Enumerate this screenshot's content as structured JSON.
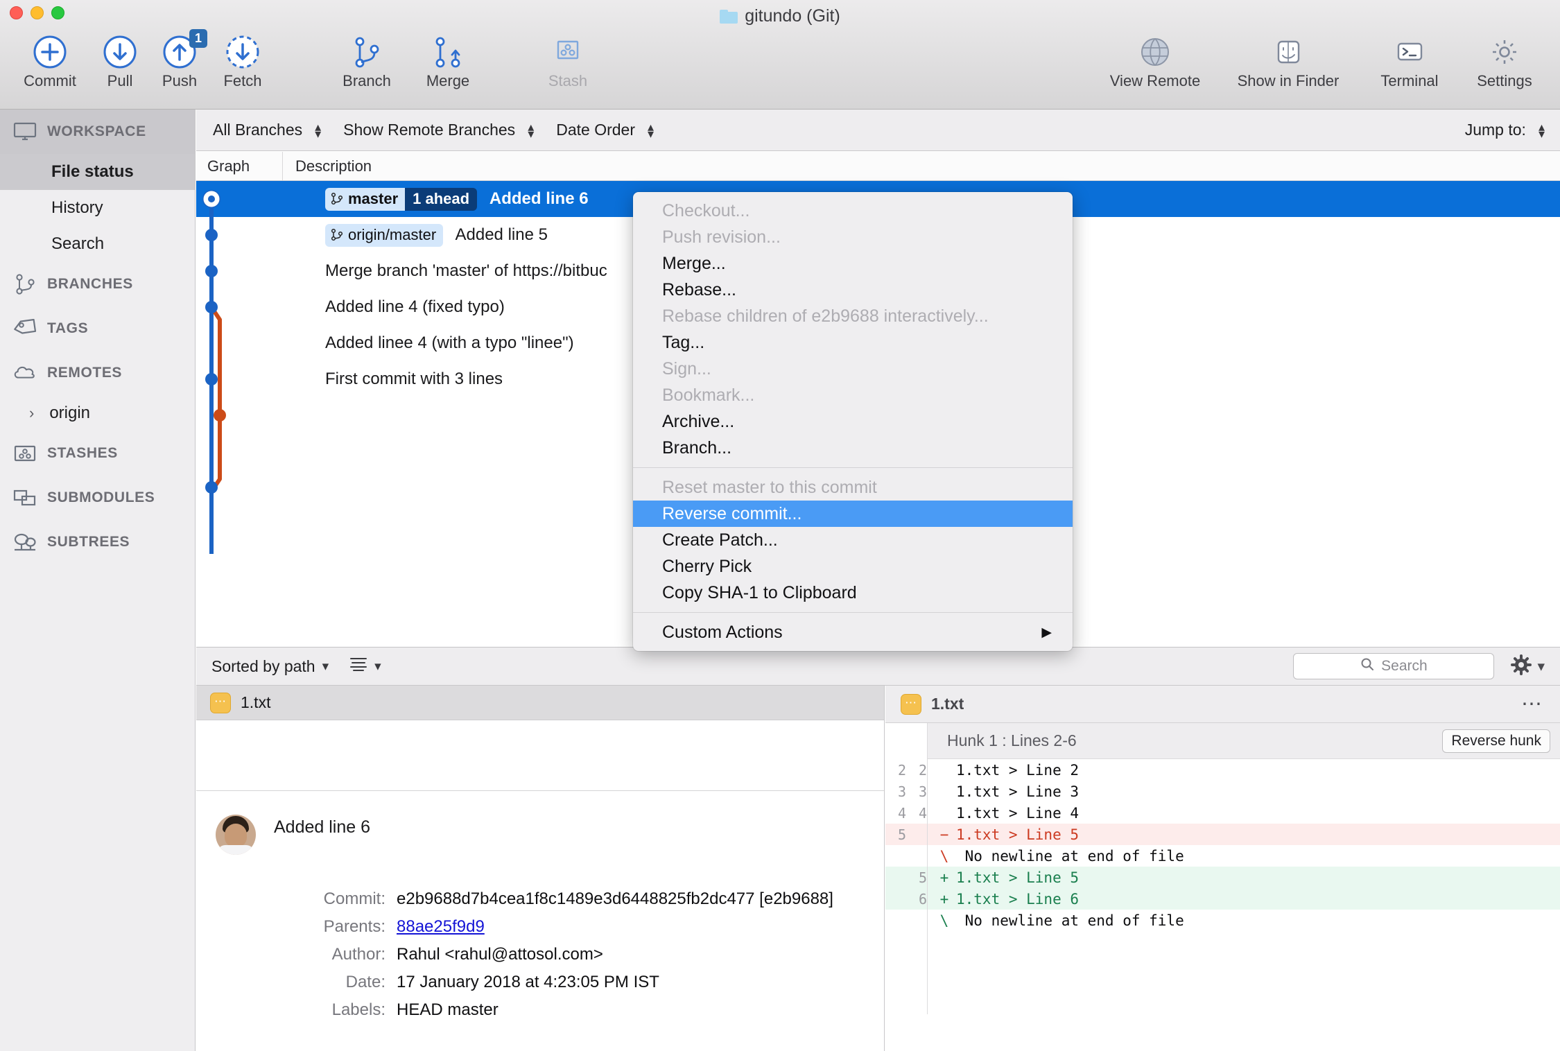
{
  "window": {
    "title": "gitundo (Git)",
    "folder_icon": "folder-icon"
  },
  "toolbar": {
    "left_buttons": [
      {
        "label": "Commit",
        "icon": "plus-circle-icon",
        "disabled": false,
        "badge": null
      },
      {
        "label": "Pull",
        "icon": "arrow-down-circle-icon",
        "disabled": false,
        "badge": null
      },
      {
        "label": "Push",
        "icon": "arrow-up-circle-icon",
        "disabled": false,
        "badge": "1"
      },
      {
        "label": "Fetch",
        "icon": "arrow-down-dashed-circle-icon",
        "disabled": false,
        "badge": null
      },
      {
        "label": "Branch",
        "icon": "branch-icon",
        "disabled": false,
        "badge": null
      },
      {
        "label": "Merge",
        "icon": "merge-icon",
        "disabled": false,
        "badge": null
      },
      {
        "label": "Stash",
        "icon": "stash-icon",
        "disabled": true,
        "badge": null
      }
    ],
    "right_buttons": [
      {
        "label": "View Remote",
        "icon": "globe-icon"
      },
      {
        "label": "Show in Finder",
        "icon": "finder-icon"
      },
      {
        "label": "Terminal",
        "icon": "terminal-icon"
      },
      {
        "label": "Settings",
        "icon": "gear-icon"
      }
    ]
  },
  "sidebar": {
    "sections": [
      {
        "label": "WORKSPACE",
        "icon": "monitor-icon",
        "active": true
      },
      {
        "label": "BRANCHES",
        "icon": "branch-icon",
        "active": false
      },
      {
        "label": "TAGS",
        "icon": "tag-icon",
        "active": false
      },
      {
        "label": "REMOTES",
        "icon": "cloud-icon",
        "active": false
      },
      {
        "label": "STASHES",
        "icon": "stash-icon",
        "active": false
      },
      {
        "label": "SUBMODULES",
        "icon": "submodule-icon",
        "active": false
      },
      {
        "label": "SUBTREES",
        "icon": "subtree-icon",
        "active": false
      }
    ],
    "workspace_items": [
      {
        "label": "File status",
        "selected": true
      },
      {
        "label": "History",
        "selected": false
      },
      {
        "label": "Search",
        "selected": false
      }
    ],
    "remote_items": [
      {
        "label": "origin",
        "chevron": "chevron-right-icon"
      }
    ]
  },
  "filterbar": {
    "branch_filter": "All Branches",
    "remote_filter": "Show Remote Branches",
    "order_filter": "Date Order",
    "jump_to_label": "Jump to:"
  },
  "columns": {
    "graph": "Graph",
    "description": "Description"
  },
  "commits": [
    {
      "description": "Added line 6",
      "selected": true,
      "refs": [
        {
          "name": "master",
          "ahead": "1 ahead",
          "type": "local"
        }
      ]
    },
    {
      "description": "Added line 5",
      "selected": false,
      "refs": [
        {
          "name": "origin/master",
          "ahead": null,
          "type": "remote"
        }
      ]
    },
    {
      "description": "Merge branch 'master' of https://bitbuc",
      "selected": false,
      "refs": []
    },
    {
      "description": "Added line 4 (fixed typo)",
      "selected": false,
      "refs": []
    },
    {
      "description": "Added linee 4 (with a typo \"linee\")",
      "selected": false,
      "refs": []
    },
    {
      "description": "First commit with 3 lines",
      "selected": false,
      "refs": []
    }
  ],
  "context_menu": {
    "items": [
      {
        "label": "Checkout...",
        "state": "disabled"
      },
      {
        "label": "Push revision...",
        "state": "disabled"
      },
      {
        "label": "Merge...",
        "state": "enabled"
      },
      {
        "label": "Rebase...",
        "state": "enabled"
      },
      {
        "label": "Rebase children of e2b9688 interactively...",
        "state": "disabled"
      },
      {
        "label": "Tag...",
        "state": "enabled"
      },
      {
        "label": "Sign...",
        "state": "disabled"
      },
      {
        "label": "Bookmark...",
        "state": "disabled"
      },
      {
        "label": "Archive...",
        "state": "enabled"
      },
      {
        "label": "Branch...",
        "state": "enabled"
      },
      {
        "label": "---",
        "state": "separator"
      },
      {
        "label": "Reset master to this commit",
        "state": "disabled"
      },
      {
        "label": "Reverse commit...",
        "state": "highlighted"
      },
      {
        "label": "Create Patch...",
        "state": "enabled"
      },
      {
        "label": "Cherry Pick",
        "state": "enabled"
      },
      {
        "label": "Copy SHA-1 to Clipboard",
        "state": "enabled"
      },
      {
        "label": "---",
        "state": "separator"
      },
      {
        "label": "Custom Actions",
        "state": "submenu",
        "arrow": "triangle-right-icon"
      }
    ],
    "highlight_color": "#4a9bf5"
  },
  "file_toolbar": {
    "sort_label": "Sorted by path",
    "sort_chevron": "chevron-down-icon",
    "view_icon": "list-view-icon",
    "view_chevron": "chevron-down-icon",
    "search_placeholder": "Search",
    "search_icon": "search-icon",
    "gear_icon": "gear-icon",
    "gear_chevron": "chevron-down-icon"
  },
  "left_panel": {
    "file_name": "1.txt",
    "file_badge_icon": "modified-file-icon",
    "commit_summary": "Added line 6",
    "avatar": "user-avatar",
    "fields": [
      {
        "key": "Commit:",
        "value": "e2b9688d7b4cea1f8c1489e3d6448825fb2dc477 [e2b9688]",
        "link": false
      },
      {
        "key": "Parents:",
        "value": "88ae25f9d9",
        "link": true
      },
      {
        "key": "Author:",
        "value": "Rahul <rahul@attosol.com>",
        "link": false
      },
      {
        "key": "Date:",
        "value": "17 January 2018 at 4:23:05 PM IST",
        "link": false
      },
      {
        "key": "Labels:",
        "value": "HEAD master",
        "link": false
      }
    ]
  },
  "diff_panel": {
    "file_name": "1.txt",
    "file_badge_icon": "modified-file-icon",
    "more_icon": "ellipsis-icon",
    "hunk_title": "Hunk 1 : Lines 2-6",
    "reverse_hunk_label": "Reverse hunk",
    "lines": [
      {
        "old": "2",
        "new": "2",
        "sign": "",
        "text": "1.txt > Line 2",
        "type": "ctx"
      },
      {
        "old": "3",
        "new": "3",
        "sign": "",
        "text": "1.txt > Line 3",
        "type": "ctx"
      },
      {
        "old": "4",
        "new": "4",
        "sign": "",
        "text": "1.txt > Line 4",
        "type": "ctx"
      },
      {
        "old": "5",
        "new": "",
        "sign": "−",
        "text": "1.txt > Line 5",
        "type": "del"
      },
      {
        "old": "",
        "new": "",
        "sign": "\\",
        "text": " No newline at end of file",
        "type": "nonl-red"
      },
      {
        "old": "",
        "new": "5",
        "sign": "+",
        "text": "1.txt > Line 5",
        "type": "add"
      },
      {
        "old": "",
        "new": "6",
        "sign": "+",
        "text": "1.txt > Line 6",
        "type": "add"
      },
      {
        "old": "",
        "new": "",
        "sign": "\\",
        "text": " No newline at end of file",
        "type": "nonl-green"
      }
    ]
  },
  "colors": {
    "selection_blue": "#0a6fd8",
    "menu_highlight": "#4a9bf5",
    "graph_branch_blue": "#1b63c4",
    "graph_branch_orange": "#cc4b18",
    "ahead_badge": "#0b3c78",
    "ref_chip": "#d4e7fb"
  }
}
